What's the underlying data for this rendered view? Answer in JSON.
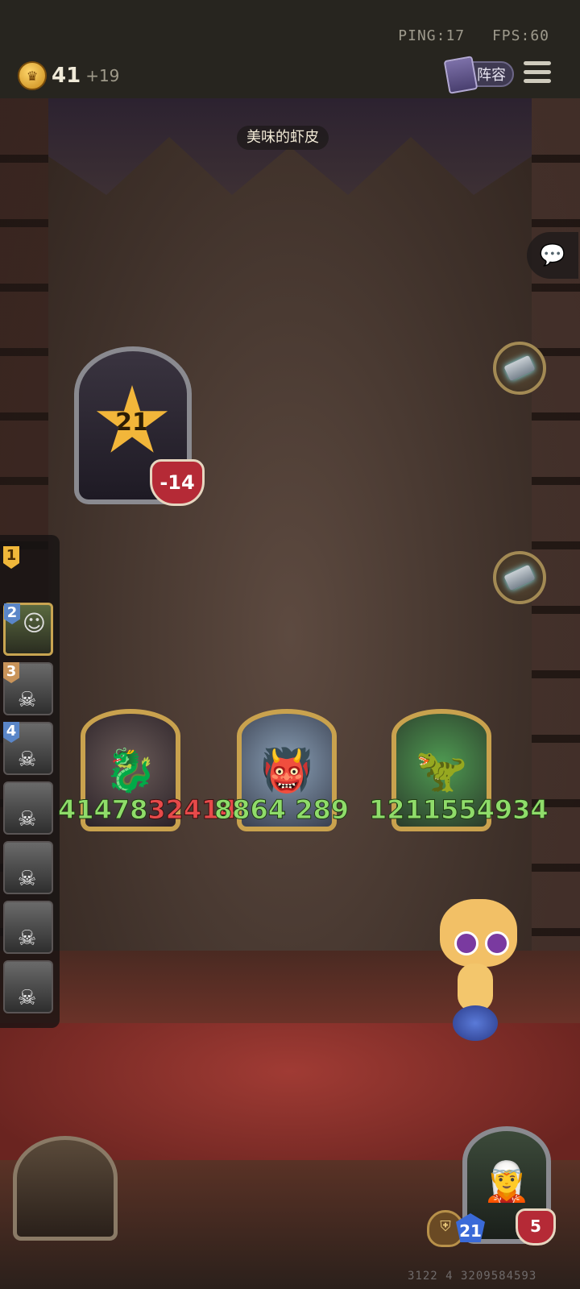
{
  "status": {
    "ping": "PING:17",
    "fps": "FPS:60"
  },
  "economy": {
    "gold": "41",
    "gold_income": "+19"
  },
  "header": {
    "lineup_label": "阵容"
  },
  "board": {
    "title": "美味的虾皮"
  },
  "opponent": {
    "tier": "21",
    "health_change": "-14"
  },
  "leaderboard": {
    "first_rank": "1",
    "players": [
      {
        "rank": "2",
        "rank_color": "#5a86c8",
        "active": true
      },
      {
        "rank": "3",
        "rank_color": "#c9945a",
        "active": false
      },
      {
        "rank": "4",
        "rank_color": "#5a86c8",
        "active": false
      },
      {
        "rank": "",
        "rank_color": "",
        "active": false
      },
      {
        "rank": "",
        "rank_color": "",
        "active": false
      },
      {
        "rank": "",
        "rank_color": "",
        "active": false
      },
      {
        "rank": "",
        "rank_color": "",
        "active": false
      }
    ]
  },
  "minions": [
    {
      "icon": "dragon",
      "attack": "41478",
      "health": "32414"
    },
    {
      "icon": "beast",
      "attack": "8864",
      "health": "289"
    },
    {
      "icon": "dinosaur",
      "attack": "1211554",
      "health": "934"
    }
  ],
  "hero": {
    "armor": "",
    "tier": "21",
    "health": "5"
  },
  "footer": {
    "id": "3122 4 3209584593"
  },
  "colors": {
    "gold": "#f2b63a",
    "frame": "#c9a24e",
    "attack_text": "#8fdc6a",
    "health_text": "#e64a4a"
  }
}
